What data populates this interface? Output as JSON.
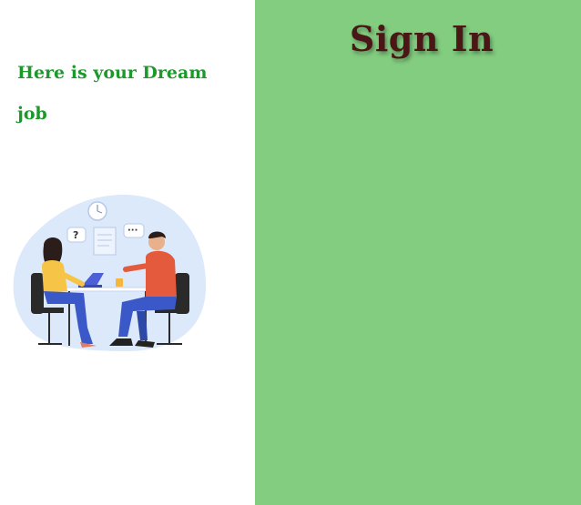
{
  "left_panel": {
    "tagline_line1": "Here is your Dream",
    "tagline_line2": "job",
    "illustration": "two-people-interview-illustration"
  },
  "right_panel": {
    "title": "Sign In"
  },
  "colors": {
    "tagline": "#1b9a2a",
    "panel_bg": "#83cd80",
    "title": "#4a1616"
  }
}
